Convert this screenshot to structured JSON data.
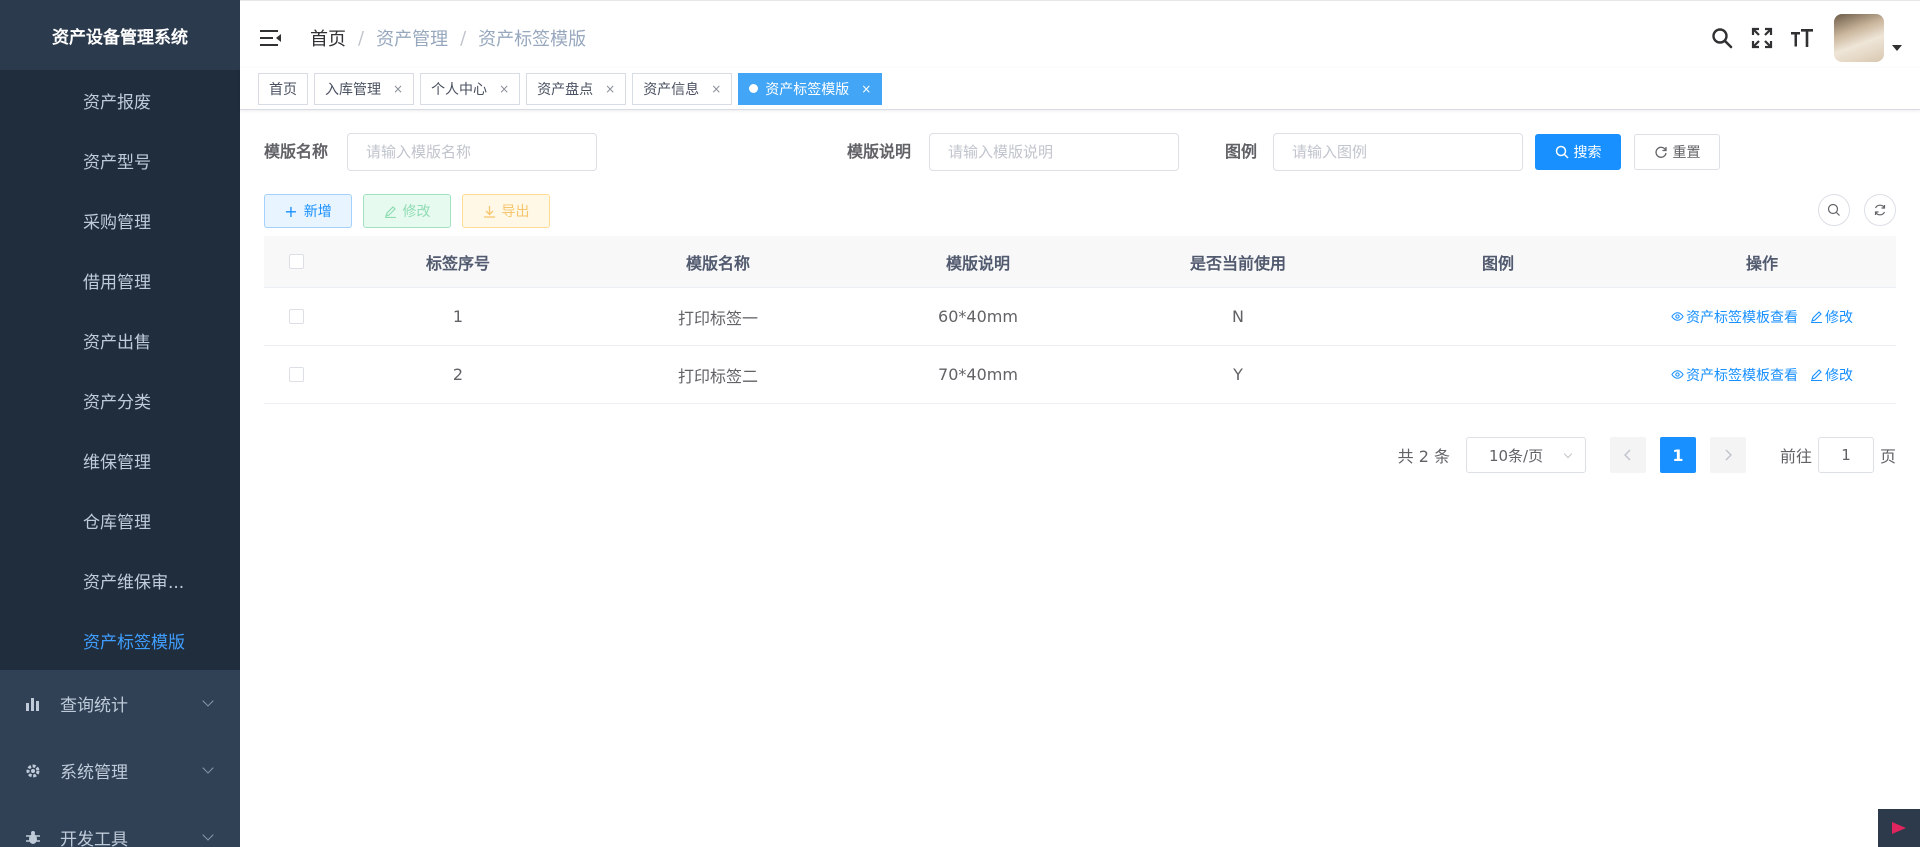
{
  "app": {
    "title": "资产设备管理系统"
  },
  "sidebar": {
    "sub_items": [
      {
        "label": "资产报废",
        "active": false
      },
      {
        "label": "资产型号",
        "active": false
      },
      {
        "label": "采购管理",
        "active": false
      },
      {
        "label": "借用管理",
        "active": false
      },
      {
        "label": "资产出售",
        "active": false
      },
      {
        "label": "资产分类",
        "active": false
      },
      {
        "label": "维保管理",
        "active": false
      },
      {
        "label": "仓库管理",
        "active": false
      },
      {
        "label": "资产维保审...",
        "active": false
      },
      {
        "label": "资产标签模版",
        "active": true
      }
    ],
    "groups": [
      {
        "label": "查询统计",
        "icon": "bar-chart-icon"
      },
      {
        "label": "系统管理",
        "icon": "gear-icon"
      },
      {
        "label": "开发工具",
        "icon": "bug-icon"
      }
    ]
  },
  "breadcrumb": {
    "home": "首页",
    "level1": "资产管理",
    "current": "资产标签模版",
    "separator": "/"
  },
  "tags": [
    {
      "label": "首页",
      "closable": false,
      "active": false
    },
    {
      "label": "入库管理",
      "closable": true,
      "active": false
    },
    {
      "label": "个人中心",
      "closable": true,
      "active": false
    },
    {
      "label": "资产盘点",
      "closable": true,
      "active": false
    },
    {
      "label": "资产信息",
      "closable": true,
      "active": false
    },
    {
      "label": "资产标签模版",
      "closable": true,
      "active": true
    }
  ],
  "tag_close_glyph": "×",
  "search": {
    "name_label": "模版名称",
    "name_placeholder": "请输入模版名称",
    "name_value": "",
    "desc_label": "模版说明",
    "desc_placeholder": "请输入模版说明",
    "desc_value": "",
    "legend_label": "图例",
    "legend_placeholder": "请输入图例",
    "legend_value": "",
    "search_button": "搜索",
    "reset_button": "重置"
  },
  "toolbar": {
    "add": "新增",
    "edit": "修改",
    "export": "导出"
  },
  "table": {
    "headers": [
      "标签序号",
      "模版名称",
      "模版说明",
      "是否当前使用",
      "图例",
      "操作"
    ],
    "rows": [
      {
        "no": "1",
        "name": "打印标签一",
        "desc": "60*40mm",
        "current": "N",
        "legend": ""
      },
      {
        "no": "2",
        "name": "打印标签二",
        "desc": "70*40mm",
        "current": "Y",
        "legend": ""
      }
    ],
    "op_view": "资产标签模板查看",
    "op_edit": "修改"
  },
  "pagination": {
    "total_text": "共 2 条",
    "page_size": "10条/页",
    "current_page": "1",
    "goto_prefix": "前往",
    "goto_value": "1",
    "goto_suffix": "页"
  },
  "colors": {
    "sidebar_bg": "#304156",
    "primary": "#1890ff",
    "active_tag": "#42a5f5"
  }
}
